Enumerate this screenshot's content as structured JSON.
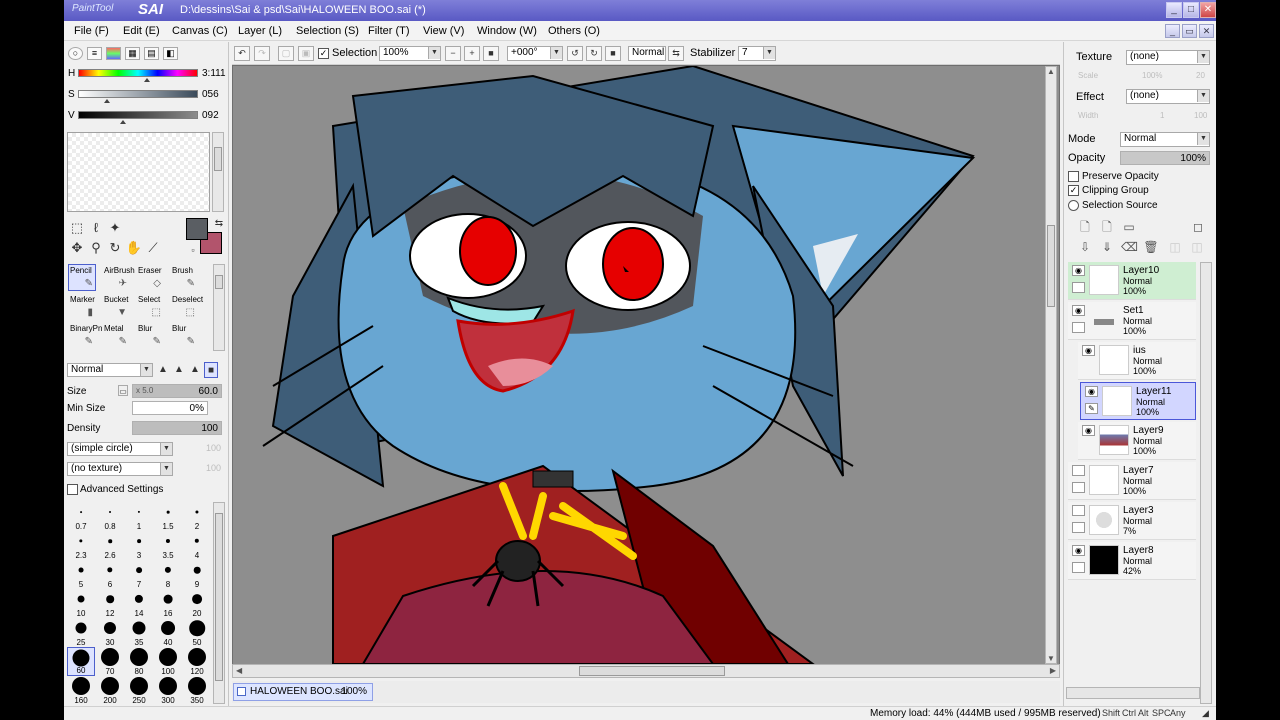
{
  "titlebar": {
    "logo_a": "PaintTool",
    "logo_b": "SAI",
    "title": "D:\\dessins\\Sai & psd\\Sai\\HALOWEEN BOO.sai (*)",
    "min": "_",
    "max": "□",
    "close": "✕"
  },
  "menu": [
    "File (F)",
    "Edit (E)",
    "Canvas (C)",
    "Layer (L)",
    "Selection (S)",
    "Filter (T)",
    "View (V)",
    "Window (W)",
    "Others (O)"
  ],
  "color": {
    "h_label": "H",
    "h_value": "3:111",
    "s_label": "S",
    "s_value": "056",
    "v_label": "V",
    "v_value": "092",
    "primary": "#5a5e63",
    "secondary": "#b2546c"
  },
  "brushes": [
    {
      "label": "Pencil",
      "icon": "✎"
    },
    {
      "label": "AirBrush",
      "icon": "✈"
    },
    {
      "label": "Eraser",
      "icon": "◇"
    },
    {
      "label": "Brush",
      "icon": "✎"
    },
    {
      "label": "Marker",
      "icon": "▮"
    },
    {
      "label": "Bucket",
      "icon": "▼"
    },
    {
      "label": "Select",
      "icon": "⬚"
    },
    {
      "label": "Deselect",
      "icon": "⬚"
    },
    {
      "label": "BinaryPn",
      "icon": "✎"
    },
    {
      "label": "Metal",
      "icon": "✎"
    },
    {
      "label": "Blur",
      "icon": "✎"
    },
    {
      "label": "Blur",
      "icon": "✎"
    }
  ],
  "brush_settings": {
    "mode": "Normal",
    "size_label": "Size",
    "size_mult": "x 5.0",
    "size_value": "60.0",
    "min_size_label": "Min Size",
    "min_size_value": "0%",
    "density_label": "Density",
    "density_value": "100",
    "shape": "(simple circle)",
    "shape_val": "100",
    "texture": "(no texture)",
    "texture_val": "100",
    "advanced": "Advanced Settings"
  },
  "brush_sizes": [
    "0.7",
    "0.8",
    "1",
    "1.5",
    "2",
    "2.3",
    "2.6",
    "3",
    "3.5",
    "4",
    "5",
    "6",
    "7",
    "8",
    "9",
    "10",
    "12",
    "14",
    "16",
    "20",
    "25",
    "30",
    "35",
    "40",
    "50",
    "60",
    "70",
    "80",
    "100",
    "120",
    "160",
    "200",
    "250",
    "300",
    "350"
  ],
  "toolbar": {
    "selection_label": "Selection",
    "zoom": "100%",
    "rotation": "+000°",
    "blend": "Normal",
    "stabilizer_label": "Stabilizer",
    "stabilizer_value": "7"
  },
  "tab": {
    "name": "HALOWEEN BOO.sai",
    "zoom": "100%"
  },
  "status": {
    "memory": "Memory load: 44% (444MB used / 995MB reserved)",
    "keys": [
      "Shift",
      "Ctrl",
      "Alt",
      "SPC",
      "Any"
    ]
  },
  "right": {
    "texture_label": "Texture",
    "texture_value": "(none)",
    "scale_label": "Scale",
    "scale_value": "100%",
    "scale_num": "20",
    "effect_label": "Effect",
    "effect_value": "(none)",
    "width_label": "Width",
    "width_value": "1",
    "width_num": "100",
    "mode_label": "Mode",
    "mode_value": "Normal",
    "opacity_label": "Opacity",
    "opacity_value": "100%",
    "preserve_opacity": "Preserve Opacity",
    "clipping_group": "Clipping Group",
    "selection_source": "Selection Source"
  },
  "layers": [
    {
      "name": "Layer10",
      "mode": "Normal",
      "opacity": "100%"
    },
    {
      "name": "Set1",
      "mode": "Normal",
      "opacity": "100%"
    },
    {
      "name": "ius",
      "mode": "Normal",
      "opacity": "100%"
    },
    {
      "name": "Layer11",
      "mode": "Normal",
      "opacity": "100%"
    },
    {
      "name": "Layer9",
      "mode": "Normal",
      "opacity": "100%"
    },
    {
      "name": "Layer7",
      "mode": "Normal",
      "opacity": "100%"
    },
    {
      "name": "Layer3",
      "mode": "Normal",
      "opacity": "7%"
    },
    {
      "name": "Layer8",
      "mode": "Normal",
      "opacity": "42%"
    }
  ]
}
